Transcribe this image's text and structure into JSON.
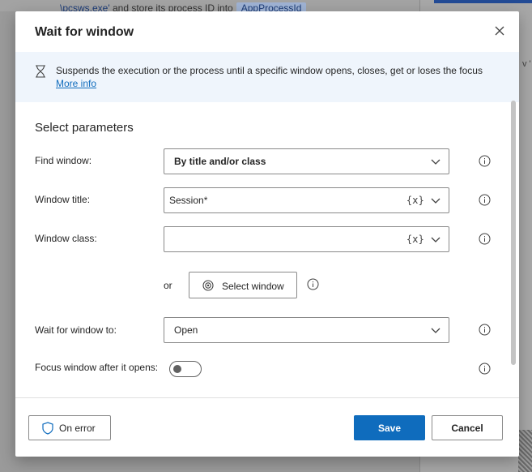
{
  "background": {
    "code_path": "\\pcsws.exe'",
    "code_text": " and store its process ID into",
    "code_token": "AppProcessId",
    "right_text": "v '"
  },
  "dialog": {
    "title": "Wait for window",
    "close_icon": "close-icon"
  },
  "banner": {
    "icon": "hourglass-icon",
    "text": "Suspends the execution or the process until a specific window opens, closes, get or loses the focus",
    "link": "More info"
  },
  "params": {
    "section_title": "Select parameters",
    "find_window": {
      "label": "Find window:",
      "value": "By title and/or class"
    },
    "window_title": {
      "label": "Window title:",
      "value": "Session*",
      "var_tag": "{x}"
    },
    "window_class": {
      "label": "Window class:",
      "value": "",
      "var_tag": "{x}"
    },
    "or_label": "or",
    "select_window_button": "Select window",
    "wait_for": {
      "label": "Wait for window to:",
      "value": "Open"
    },
    "focus_window": {
      "label": "Focus window after it opens:",
      "enabled": false
    }
  },
  "footer": {
    "on_error": "On error",
    "save": "Save",
    "cancel": "Cancel"
  },
  "colors": {
    "accent": "#0f6cbd",
    "banner_bg": "#eff5fc",
    "text": "#242424",
    "border": "#8a8a8a"
  }
}
